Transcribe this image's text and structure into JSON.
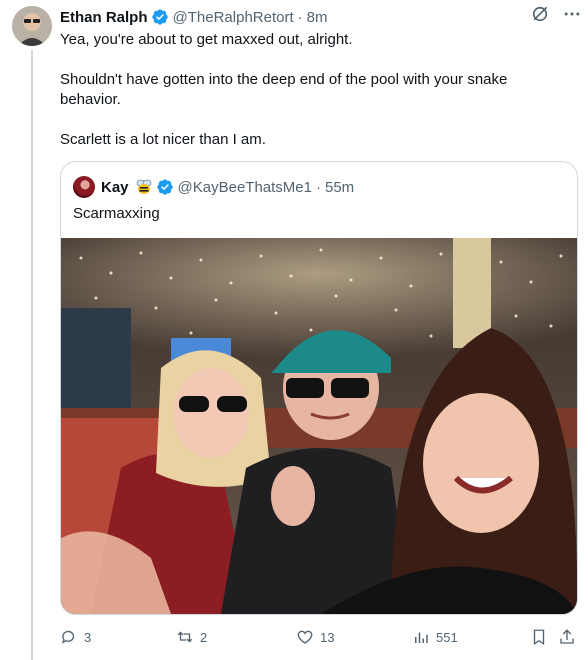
{
  "tweet": {
    "author_name": "Ethan Ralph",
    "handle": "@TheRalphRetort",
    "separator": "·",
    "time": "8m",
    "paragraphs": [
      "Yea, you're about to get maxxed out, alright.",
      "Shouldn't have gotten into the deep end of the pool with your snake behavior.",
      "Scarlett is a lot nicer than I am."
    ]
  },
  "quote": {
    "author_name": "Kay",
    "handle": "@KayBeeThatsMe1",
    "separator": "·",
    "time": "55m",
    "text": "Scarmaxxing",
    "image_alt": "Selfie of three people in a casino, one wearing a teal cap"
  },
  "actions": {
    "replies": "3",
    "reposts": "2",
    "likes": "13",
    "views": "551"
  },
  "colors": {
    "verified": "#1d9bf0",
    "secondary_text": "#536471",
    "border": "#cfd9de"
  }
}
